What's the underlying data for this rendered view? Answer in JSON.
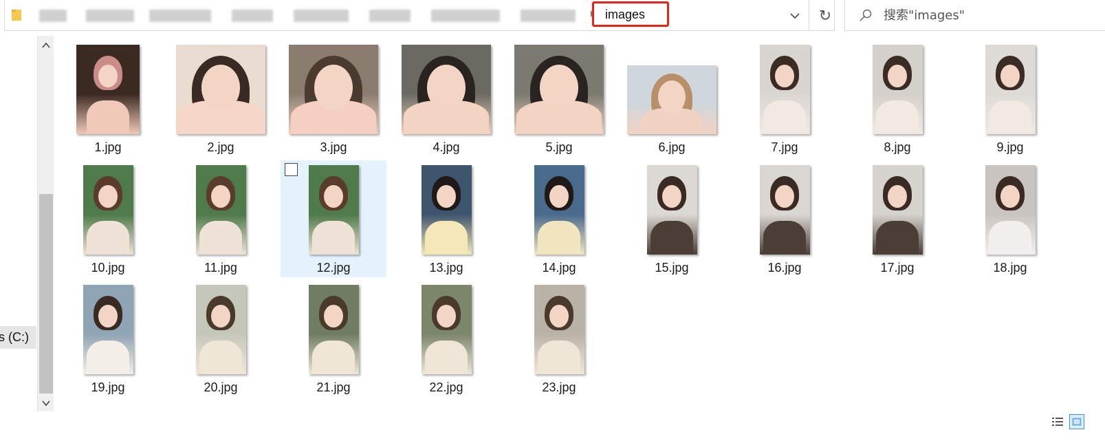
{
  "address_bar": {
    "current_folder": "images",
    "refresh_symbol": "↻"
  },
  "search": {
    "placeholder": "搜索\"images\""
  },
  "navigation": {
    "drive_label": "s (C:)"
  },
  "files": [
    {
      "name": "1.jpg",
      "shape": "mid",
      "palette": [
        "#3b2a22",
        "#c98c88",
        "#f0c9b8"
      ]
    },
    {
      "name": "2.jpg",
      "shape": "wide",
      "palette": [
        "#e8ddd0",
        "#3a2a24",
        "#f5d6c8"
      ]
    },
    {
      "name": "3.jpg",
      "shape": "wide",
      "palette": [
        "#8a7d70",
        "#4a3a30",
        "#f5d0c2"
      ]
    },
    {
      "name": "4.jpg",
      "shape": "wide",
      "palette": [
        "#6b6a62",
        "#2a2420",
        "#f3d3c1"
      ]
    },
    {
      "name": "5.jpg",
      "shape": "wide",
      "palette": [
        "#7b7a70",
        "#2a2420",
        "#f3d3c1"
      ]
    },
    {
      "name": "6.jpg",
      "shape": "small",
      "palette": [
        "#cfd6dc",
        "#b7906a",
        "#f2d3c3"
      ]
    },
    {
      "name": "7.jpg",
      "shape": "tall",
      "palette": [
        "#d9d6d2",
        "#3a2c24",
        "#f1e9e2"
      ]
    },
    {
      "name": "8.jpg",
      "shape": "tall",
      "palette": [
        "#d4d0cb",
        "#3a2c24",
        "#f1e9e2"
      ]
    },
    {
      "name": "9.jpg",
      "shape": "tall",
      "palette": [
        "#dedbd7",
        "#3a2c24",
        "#f1e9e2"
      ]
    },
    {
      "name": "10.jpg",
      "shape": "tall",
      "palette": [
        "#4f7a4a",
        "#5a3c2c",
        "#eee3d6"
      ]
    },
    {
      "name": "11.jpg",
      "shape": "tall",
      "palette": [
        "#4f7a4a",
        "#5a3c2c",
        "#eee3d6"
      ]
    },
    {
      "name": "12.jpg",
      "shape": "tall",
      "palette": [
        "#4f7a4a",
        "#5a3c2c",
        "#eee3d6"
      ],
      "selected": true
    },
    {
      "name": "13.jpg",
      "shape": "tall",
      "palette": [
        "#3f556e",
        "#1f1a18",
        "#f4e8b8"
      ]
    },
    {
      "name": "14.jpg",
      "shape": "tall",
      "palette": [
        "#4a6a8c",
        "#1f1a18",
        "#f1e6c0"
      ]
    },
    {
      "name": "15.jpg",
      "shape": "tall",
      "palette": [
        "#dcd8d4",
        "#3a2a24",
        "#4a3e36"
      ]
    },
    {
      "name": "16.jpg",
      "shape": "tall",
      "palette": [
        "#dad6d2",
        "#3a2a24",
        "#4a3e36"
      ]
    },
    {
      "name": "17.jpg",
      "shape": "tall",
      "palette": [
        "#d6d2ce",
        "#3a2a24",
        "#4a3e36"
      ]
    },
    {
      "name": "18.jpg",
      "shape": "tall",
      "palette": [
        "#c9c4bf",
        "#3a2a24",
        "#f2efec"
      ]
    },
    {
      "name": "19.jpg",
      "shape": "tall",
      "palette": [
        "#8fa4b4",
        "#3a2a24",
        "#f4efe9"
      ]
    },
    {
      "name": "20.jpg",
      "shape": "tall",
      "palette": [
        "#c6c7bb",
        "#4a3a2c",
        "#f0e6d8"
      ]
    },
    {
      "name": "21.jpg",
      "shape": "tall",
      "palette": [
        "#6f7e62",
        "#4a3a2c",
        "#f0e6d8"
      ]
    },
    {
      "name": "22.jpg",
      "shape": "tall",
      "palette": [
        "#7b866b",
        "#4a3a2c",
        "#f0e6d8"
      ]
    },
    {
      "name": "23.jpg",
      "shape": "tall",
      "palette": [
        "#b9b3a6",
        "#4a3a2c",
        "#f0e6d8"
      ]
    }
  ],
  "icons": {
    "folder": "folder-icon",
    "dropdown": "chevron-down-icon",
    "refresh": "refresh-icon",
    "search": "search-icon",
    "scroll_up": "chevron-up-icon",
    "scroll_down": "chevron-down-icon",
    "view_details": "details-view-icon",
    "view_large": "large-icons-view-icon"
  },
  "colors": {
    "address_highlight": "#e8231a",
    "selection": "#e5f3ff"
  }
}
